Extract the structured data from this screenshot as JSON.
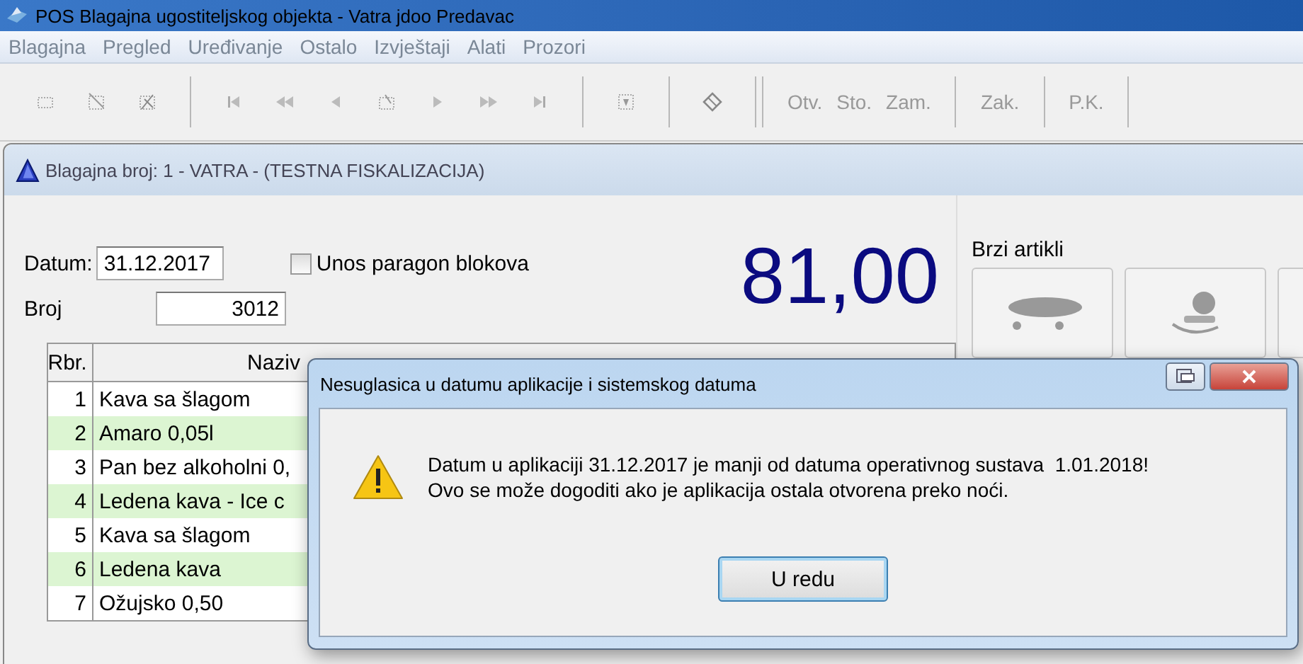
{
  "window": {
    "title": "POS Blagajna ugostiteljskog objekta - Vatra jdoo Predavac"
  },
  "menu": [
    "Blagajna",
    "Pregled",
    "Uređivanje",
    "Ostalo",
    "Izvještaji",
    "Alati",
    "Prozori"
  ],
  "toolbar": {
    "text_groups": [
      [
        {
          "label": "Otv.",
          "disabled": true
        },
        {
          "label": "Sto.",
          "disabled": true
        },
        {
          "label": "Zam.",
          "disabled": true
        }
      ],
      [
        {
          "label": "Zak.",
          "disabled": true
        }
      ],
      [
        {
          "label": "P.K.",
          "disabled": true
        }
      ]
    ]
  },
  "register_window": {
    "title": "Blagajna broj: 1 - VATRA - (TESTNA FISKALIZACIJA)",
    "date": {
      "label": "Datum:",
      "value": "31.12.2017"
    },
    "paragon": {
      "label": "Unos paragon blokova",
      "checked": false
    },
    "number": {
      "label": "Broj",
      "value": "3012"
    },
    "total": "81,00",
    "quick_items": {
      "title": "Brzi artikli"
    },
    "table": {
      "columns": [
        "Rbr.",
        "Naziv"
      ],
      "rows": [
        {
          "number": "1",
          "name": "Kava sa šlagom"
        },
        {
          "number": "2",
          "name": "Amaro 0,05l"
        },
        {
          "number": "3",
          "name": "Pan bez alkoholni 0,"
        },
        {
          "number": "4",
          "name": "Ledena kava - Ice c"
        },
        {
          "number": "5",
          "name": "Kava sa šlagom"
        },
        {
          "number": "6",
          "name": "Ledena kava"
        },
        {
          "number": "7",
          "name": "Ožujsko 0,50"
        }
      ]
    }
  },
  "dialog": {
    "title": "Nesuglasica u datumu aplikacije i sistemskog datuma",
    "message_lines": [
      "Datum u aplikaciji 31.12.2017 je manji od datuma operativnog sustava  1.01.2018!",
      "Ovo se može dogoditi ako je aplikacija ostala otvorena preko noći."
    ],
    "button": "U redu"
  }
}
